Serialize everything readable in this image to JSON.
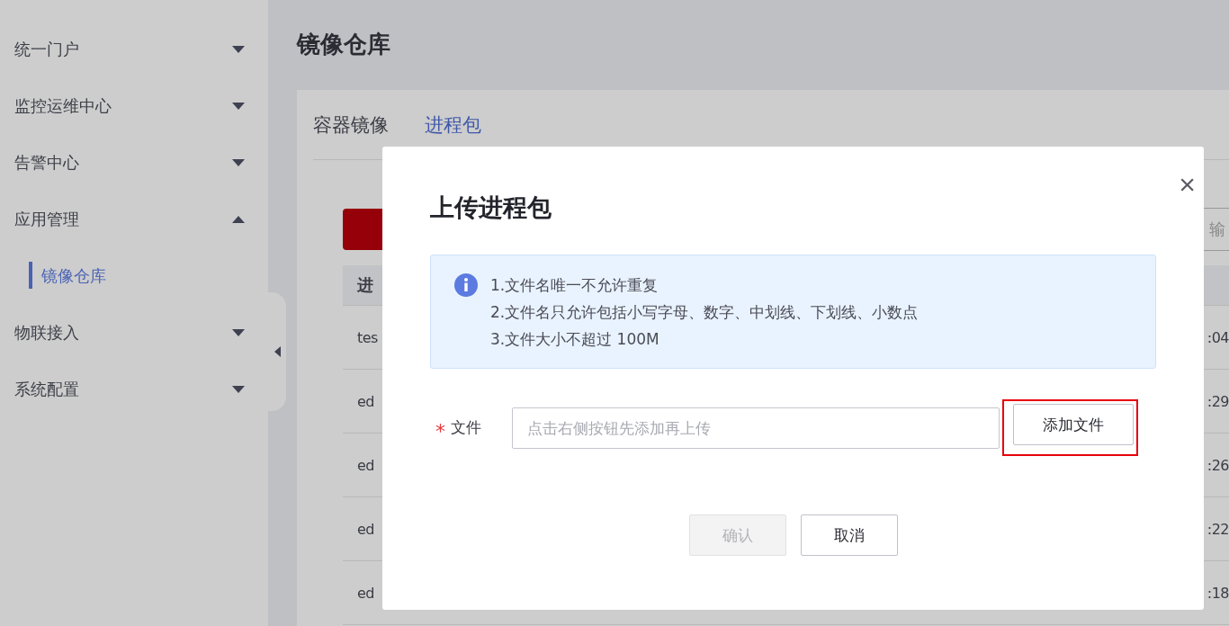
{
  "sidebar": {
    "items": [
      {
        "label": "统一门户",
        "expanded": false
      },
      {
        "label": "监控运维中心",
        "expanded": false
      },
      {
        "label": "告警中心",
        "expanded": false
      },
      {
        "label": "应用管理",
        "expanded": true,
        "children": [
          {
            "label": "镜像仓库",
            "selected": true
          }
        ]
      },
      {
        "label": "物联接入",
        "expanded": false
      },
      {
        "label": "系统配置",
        "expanded": false
      }
    ]
  },
  "page": {
    "title": "镜像仓库",
    "tabs": [
      {
        "label": "容器镜像",
        "selected": false
      },
      {
        "label": "进程包",
        "selected": true
      }
    ],
    "search": {
      "placeholder": "输"
    },
    "table": {
      "header": "进",
      "rows": [
        {
          "column_1": "tes",
          "column_2": ":04"
        },
        {
          "column_1": "ed",
          "column_2": ":29"
        },
        {
          "column_1": "ed",
          "column_2": ":26"
        },
        {
          "column_1": "ed",
          "column_2": ":22"
        },
        {
          "column_1": "ed",
          "column_2": ":18"
        }
      ]
    }
  },
  "dialog": {
    "title": "上传进程包",
    "close": "×",
    "notes": [
      "1.文件名唯一不允许重复",
      "2.文件名只允许包括小写字母、数字、中划线、下划线、小数点",
      "3.文件大小不超过 100M"
    ],
    "field": {
      "label": "文件",
      "required_mark": "*",
      "placeholder": "点击右侧按钮先添加再上传"
    },
    "add_button": {
      "label": "添加文件",
      "highlighted": true
    },
    "buttons": [
      {
        "label": "确认",
        "disabled": true
      },
      {
        "label": "取消",
        "disabled": false
      }
    ]
  }
}
